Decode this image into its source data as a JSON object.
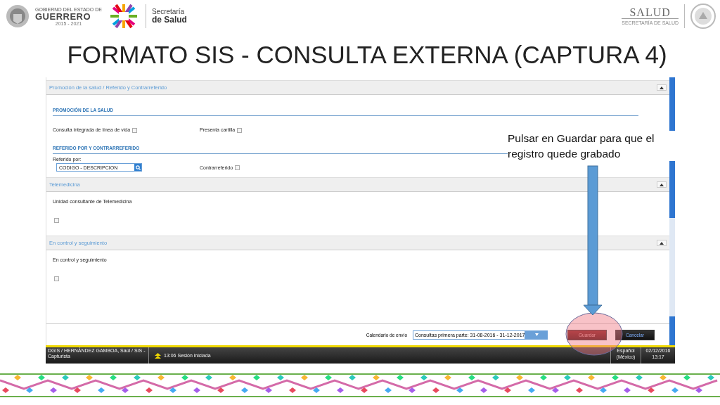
{
  "header": {
    "state_logo": {
      "line1": "GOBIERNO DEL ESTADO DE",
      "line2": "GUERRERO",
      "line3": "2015 - 2021"
    },
    "ministry_logo": {
      "line1": "Secretaría",
      "line2": "de Salud"
    },
    "federal_logo": {
      "name": "SALUD",
      "subtitle": "SECRETARÍA DE SALUD"
    }
  },
  "title": "FORMATO SIS - CONSULTA EXTERNA (CAPTURA 4)",
  "panels": [
    {
      "title": "Promoción de la salud / Referido y Contrarreferido",
      "expanded": true,
      "rows": [
        [
          {
            "kind": "heading",
            "label": "PROMOCIÓN DE LA SALUD"
          }
        ],
        [
          {
            "kind": "checkbox",
            "label": "Consulta integrada de línea de vida",
            "checked": false
          },
          {
            "kind": "checkbox",
            "label": "Presenta cartilla",
            "checked": false
          }
        ],
        [
          {
            "kind": "heading",
            "label": "REFERIDO POR Y CONTRARREFERIDO"
          }
        ],
        [
          {
            "kind": "lookup",
            "label": "Referido por:",
            "value": "CODIGO - DESCRIPCION"
          },
          {
            "kind": "checkbox",
            "label": "Contrarreferido",
            "checked": false
          }
        ]
      ]
    },
    {
      "title": "Telemedicina",
      "expanded": true,
      "rows": [
        [
          {
            "kind": "stacked-checkbox",
            "label": "Unidad consultante de Telemedicina",
            "checked": false
          }
        ]
      ]
    },
    {
      "title": "En control y seguimiento",
      "expanded": true,
      "rows": [
        [
          {
            "kind": "stacked-checkbox",
            "label": "En control y seguimiento",
            "checked": false
          }
        ]
      ]
    }
  ],
  "footer": {
    "calendar_label": "Calendario de envío",
    "calendar_value": "Consultas primera parte: 31-08-2016 - 31-12-2017",
    "buttons": [
      {
        "label": "Guardar",
        "kind": "save"
      },
      {
        "label": "Cancelar",
        "kind": "cancel"
      }
    ]
  },
  "status_bar": {
    "user": "DGIS / HERNÁNDEZ GAMBOA, Saúl / SIS - Capturista",
    "session": "13:06 Sesión iniciada",
    "language": "Español (México)",
    "datetime": "02/12/2016 13:17"
  },
  "callout": "Pulsar en Guardar para que el registro quede grabado"
}
